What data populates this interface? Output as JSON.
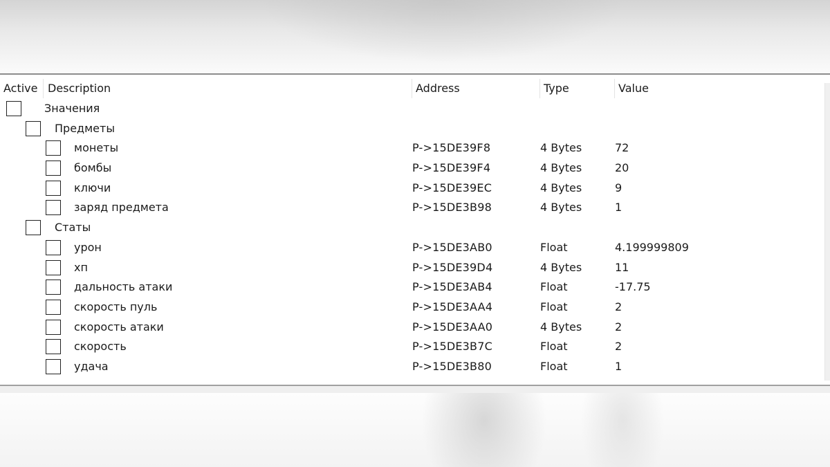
{
  "table": {
    "columns": {
      "active": "Active",
      "description": "Description",
      "address": "Address",
      "type": "Type",
      "value": "Value"
    },
    "rows": [
      {
        "level": 0,
        "description": "Значения",
        "address": "",
        "type": "",
        "value": "",
        "checked": false
      },
      {
        "level": 1,
        "description": "Предметы",
        "address": "",
        "type": "",
        "value": "",
        "checked": false
      },
      {
        "level": 2,
        "description": "монеты",
        "address": "P->15DE39F8",
        "type": "4 Bytes",
        "value": "72",
        "checked": false
      },
      {
        "level": 2,
        "description": "бомбы",
        "address": "P->15DE39F4",
        "type": "4 Bytes",
        "value": "20",
        "checked": false
      },
      {
        "level": 2,
        "description": "ключи",
        "address": "P->15DE39EC",
        "type": "4 Bytes",
        "value": "9",
        "checked": false
      },
      {
        "level": 2,
        "description": "заряд предмета",
        "address": "P->15DE3B98",
        "type": "4 Bytes",
        "value": "1",
        "checked": false
      },
      {
        "level": 1,
        "description": "Статы",
        "address": "",
        "type": "",
        "value": "",
        "checked": false
      },
      {
        "level": 2,
        "description": "урон",
        "address": "P->15DE3AB0",
        "type": "Float",
        "value": "4.199999809",
        "checked": false
      },
      {
        "level": 2,
        "description": "хп",
        "address": "P->15DE39D4",
        "type": "4 Bytes",
        "value": "11",
        "checked": false
      },
      {
        "level": 2,
        "description": "дальность атаки",
        "address": "P->15DE3AB4",
        "type": "Float",
        "value": "-17.75",
        "checked": false
      },
      {
        "level": 2,
        "description": "скорость пуль",
        "address": "P->15DE3AA4",
        "type": "Float",
        "value": "2",
        "checked": false
      },
      {
        "level": 2,
        "description": "скорость атаки",
        "address": "P->15DE3AA0",
        "type": "4 Bytes",
        "value": "2",
        "checked": false
      },
      {
        "level": 2,
        "description": "скорость",
        "address": "P->15DE3B7C",
        "type": "Float",
        "value": "2",
        "checked": false
      },
      {
        "level": 2,
        "description": "удача",
        "address": "P->15DE3B80",
        "type": "Float",
        "value": "1",
        "checked": false
      }
    ]
  }
}
